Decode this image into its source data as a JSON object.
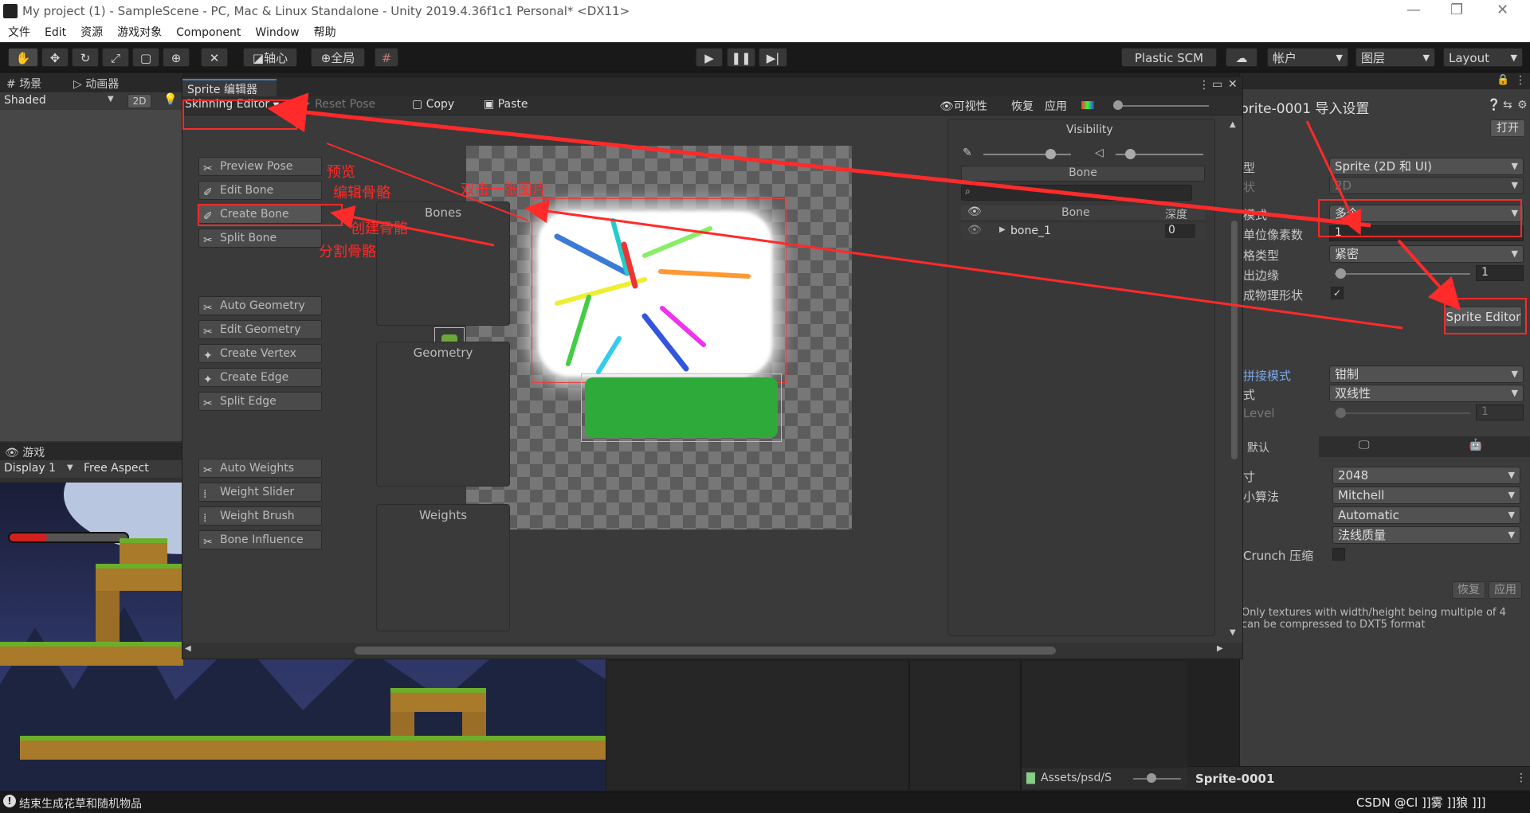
{
  "window": {
    "title": "My project (1) - SampleScene - PC, Mac & Linux Standalone - Unity 2019.4.36f1c1 Personal* <DX11>"
  },
  "menu": [
    "文件",
    "Edit",
    "资源",
    "游戏对象",
    "Component",
    "Window",
    "帮助"
  ],
  "toolbar": {
    "pivot": "轴心",
    "global": "全局",
    "plastic": "Plastic SCM",
    "account": "帐户",
    "layers": "图层",
    "layout": "Layout"
  },
  "scene": {
    "tab_scene": "场景",
    "tab_animator": "动画器",
    "shading": "Shaded",
    "mode2d": "2D"
  },
  "game": {
    "tab": "游戏",
    "display": "Display 1",
    "aspect": "Free Aspect"
  },
  "sprite_editor": {
    "tab": "Sprite 编辑器",
    "mode": "Skinning Editor",
    "reset_pose": "Reset Pose",
    "copy": "Copy",
    "paste": "Paste",
    "visibility_btn": "可视性",
    "revert": "恢复",
    "apply": "应用",
    "groups": [
      {
        "title": "Bones",
        "buttons": [
          "Preview Pose",
          "Edit Bone",
          "Create Bone",
          "Split Bone"
        ]
      },
      {
        "title": "Geometry",
        "buttons": [
          "Auto Geometry",
          "Edit Geometry",
          "Create Vertex",
          "Create Edge",
          "Split Edge"
        ]
      },
      {
        "title": "Weights",
        "buttons": [
          "Auto Weights",
          "Weight Slider",
          "Weight Brush",
          "Bone Influence"
        ]
      }
    ],
    "visibility_panel": {
      "title": "Visibility",
      "tab": "Bone",
      "col_bone": "Bone",
      "col_depth": "深度",
      "bone_name": "bone_1",
      "bone_depth": "0"
    }
  },
  "annotations": {
    "preview": "预览",
    "edit_bone": "编辑骨骼",
    "create_bone": "创建骨骼",
    "split_bone": "分割骨骼",
    "double_click": "双击一张图片"
  },
  "inspector": {
    "title": "prite-0001 导入设置",
    "open": "打开",
    "rows": [
      {
        "label": "型",
        "value": "Sprite (2D 和 UI)"
      },
      {
        "label": "状",
        "value": "2D"
      },
      {
        "label": "模式",
        "value": "多个"
      },
      {
        "label": "单位像素数",
        "value": "1"
      },
      {
        "label": "格类型",
        "value": "紧密"
      },
      {
        "label": "出边缘",
        "value": "1"
      },
      {
        "label": "成物理形状",
        "value": ""
      }
    ],
    "sprite_editor_btn": "Sprite Editor",
    "wrap_label": "拼接模式",
    "wrap_value": "钳制",
    "filter_label": "式",
    "filter_value": "双线性",
    "aniso_label": "Level",
    "aniso_value": "1",
    "platform_default": "默认",
    "size_label": "寸",
    "size_value": "2048",
    "resize_label": "小算法",
    "resize_value": "Mitchell",
    "format_value": "Automatic",
    "compression_value": "法线质量",
    "crunch_label": "Crunch 压缩",
    "revert": "恢复",
    "apply": "应用",
    "warning": "Only textures with width/height being multiple of 4 can be compressed to DXT5 format",
    "bottom_name": "Sprite-0001"
  },
  "project": {
    "path": "Assets/psd/S"
  },
  "status": {
    "message": "结束生成花草和随机物品",
    "watermark": "CSDN @Cl ]]雾 ]]狼 ]]]"
  }
}
